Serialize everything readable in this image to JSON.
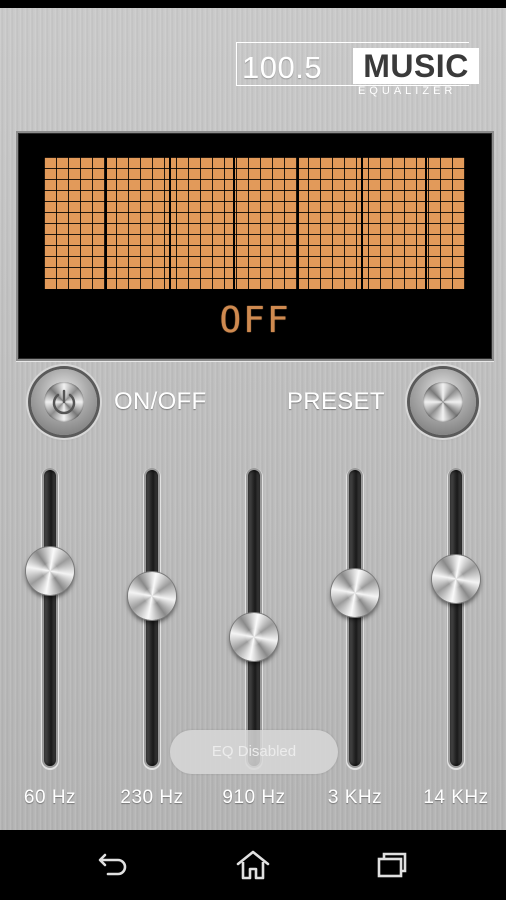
{
  "logo": {
    "frequency": "100.5",
    "music": "MUSIC",
    "subtitle": "EQUALIZER"
  },
  "display": {
    "status": "OFF",
    "grid_color": "#e29a5a"
  },
  "controls": {
    "onoff_label": "ON/OFF",
    "preset_label": "PRESET"
  },
  "sliders": [
    {
      "label": "60 Hz",
      "level": 0.67
    },
    {
      "label": "230 Hz",
      "level": 0.58
    },
    {
      "label": "910 Hz",
      "level": 0.43
    },
    {
      "label": "3 KHz",
      "level": 0.59
    },
    {
      "label": "14 KHz",
      "level": 0.64
    }
  ],
  "toast": {
    "message": "EQ Disabled"
  },
  "navbar": {
    "icons": [
      "back-icon",
      "home-icon",
      "recents-icon"
    ]
  }
}
